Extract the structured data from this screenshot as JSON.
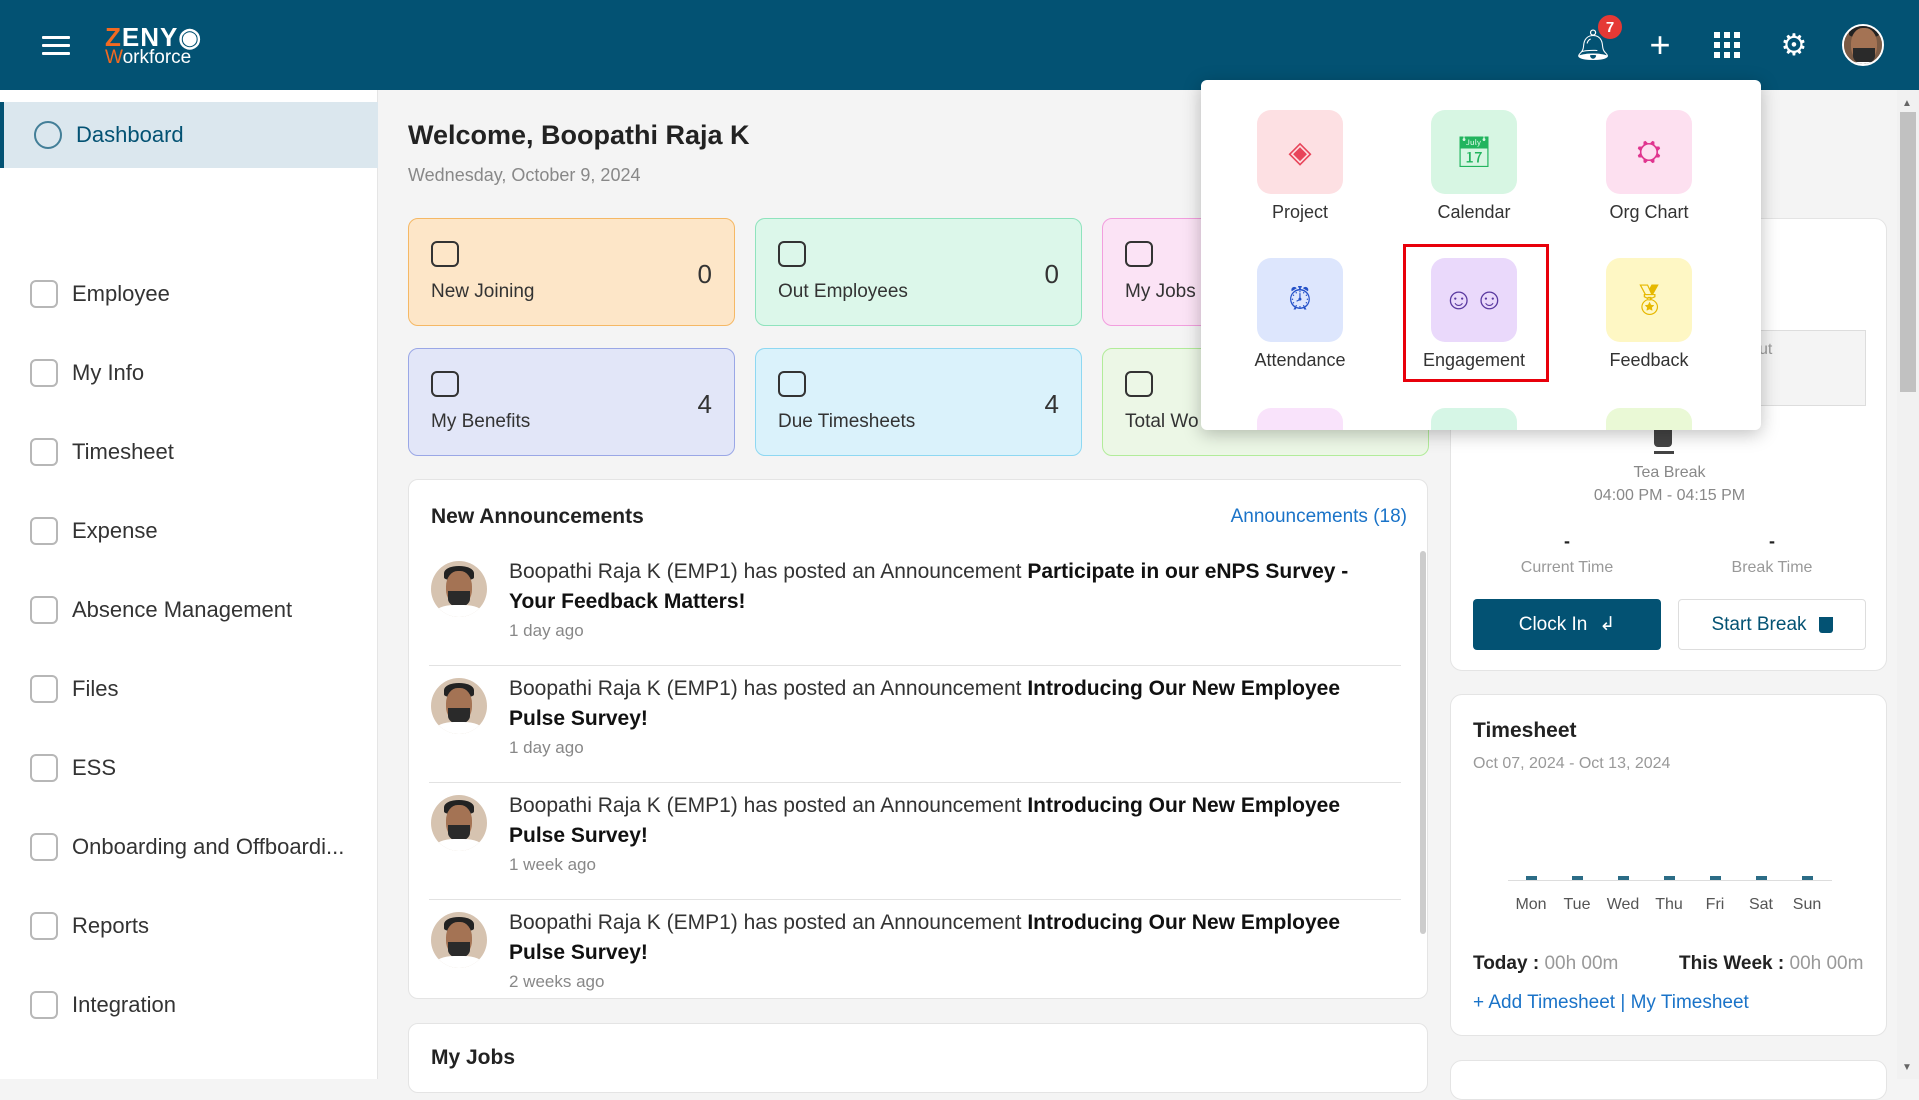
{
  "header": {
    "logo_line1_first": "Z",
    "logo_line1_rest": "ENY",
    "logo_line2_first": "W",
    "logo_line2_rest": "orkforce",
    "notification_count": "7",
    "colors": {
      "header_bg": "#035273",
      "accent": "#f26a21",
      "badge": "#e53935"
    },
    "icons": [
      "menu-icon",
      "bell-icon",
      "plus-icon",
      "apps-grid-icon",
      "gear-icon",
      "avatar"
    ]
  },
  "sidebar": {
    "items": [
      {
        "label": "Dashboard",
        "active": true
      },
      {
        "label": "Employee"
      },
      {
        "label": "My Info"
      },
      {
        "label": "Timesheet"
      },
      {
        "label": "Expense"
      },
      {
        "label": "Absence Management"
      },
      {
        "label": "Files"
      },
      {
        "label": "ESS"
      },
      {
        "label": "Onboarding and Offboardi..."
      },
      {
        "label": "Reports"
      },
      {
        "label": "Integration"
      }
    ]
  },
  "main": {
    "welcome": "Welcome, Boopathi Raja K",
    "date": "Wednesday, October 9, 2024",
    "cards": [
      {
        "label": "New Joining",
        "value": "0",
        "bg": "#fde6c8",
        "border": "#f5b865"
      },
      {
        "label": "Out Employees",
        "value": "0",
        "bg": "#dcf7ea",
        "border": "#8fe3bd"
      },
      {
        "label": "My Jobs",
        "value": "",
        "bg": "#fbe3f5",
        "border": "#f29ede"
      },
      {
        "label": "My Benefits",
        "value": "4",
        "bg": "#e2e6f8",
        "border": "#9aa7e6"
      },
      {
        "label": "Due Timesheets",
        "value": "4",
        "bg": "#daf2fb",
        "border": "#8ed8f2"
      },
      {
        "label": "Total Wo",
        "value": "",
        "bg": "#ecf7e6",
        "border": "#b2ec9a"
      }
    ],
    "announcements": {
      "title": "New Announcements",
      "link": "Announcements (18)",
      "items": [
        {
          "prefix": "Boopathi Raja K (EMP1) has posted an Announcement ",
          "title": "Participate in our eNPS Survey - Your Feedback Matters!",
          "time": "1 day ago"
        },
        {
          "prefix": "Boopathi Raja K (EMP1) has posted an Announcement ",
          "title": "Introducing Our New Employee Pulse Survey!",
          "time": "1 day ago"
        },
        {
          "prefix": "Boopathi Raja K (EMP1) has posted an Announcement ",
          "title": "Introducing Our New Employee Pulse Survey!",
          "time": "1 week ago"
        },
        {
          "prefix": "Boopathi Raja K (EMP1) has posted an Announcement ",
          "title": "Introducing Our New Employee Pulse Survey!",
          "time": "2 weeks ago"
        }
      ]
    },
    "my_jobs_title": "My Jobs"
  },
  "apps_popup": {
    "items": [
      {
        "label": "Project",
        "icon": "layers-icon",
        "bg": "#fde0e3",
        "fg": "#e8455a"
      },
      {
        "label": "Calendar",
        "icon": "calendar-icon",
        "bg": "#d7f6e3",
        "fg": "#22b45e"
      },
      {
        "label": "Org Chart",
        "icon": "org-chart-icon",
        "bg": "#fde0f0",
        "fg": "#e0358f"
      },
      {
        "label": "Attendance",
        "icon": "alarm-clock-icon",
        "bg": "#dde6fd",
        "fg": "#2451c8"
      },
      {
        "label": "Engagement",
        "icon": "smiley-faces-icon",
        "bg": "#ead9fb",
        "fg": "#5b3aa0",
        "highlighted": true
      },
      {
        "label": "Feedback",
        "icon": "award-badge-icon",
        "bg": "#fef7c4",
        "fg": "#e6b800"
      }
    ],
    "partial_row_bgs": [
      "#f9e3fb",
      "#d6f6e6",
      "#eaf9d6"
    ]
  },
  "attendance": {
    "partial_label": "ut",
    "tea_break_label": "Tea Break",
    "tea_break_time": "04:00 PM - 04:15 PM",
    "current_time_value": "-",
    "current_time_label": "Current Time",
    "break_time_value": "-",
    "break_time_label": "Break Time",
    "clock_in": "Clock In",
    "start_break": "Start Break"
  },
  "timesheet": {
    "title": "Timesheet",
    "range": "Oct 07, 2024 - Oct 13, 2024",
    "days": [
      "Mon",
      "Tue",
      "Wed",
      "Thu",
      "Fri",
      "Sat",
      "Sun"
    ],
    "hours": [
      0,
      0,
      0,
      0,
      0,
      0,
      0
    ],
    "today_label": "Today :",
    "today_value": "00h 00m",
    "week_label": "This Week :",
    "week_value": "00h 00m",
    "add_link": "+ Add Timesheet",
    "sep": "|",
    "my_link": "My Timesheet"
  }
}
